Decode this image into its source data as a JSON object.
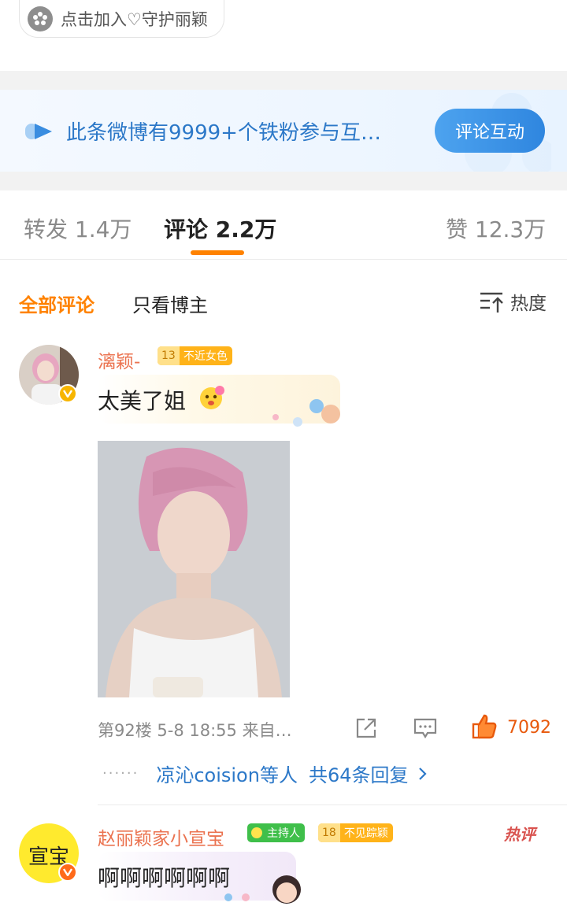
{
  "top": {
    "join_label": "点击加入♡守护丽颖"
  },
  "fans_banner": {
    "text": "此条微博有9999+个铁粉参与互…",
    "button_label": "评论互动"
  },
  "tabs": [
    {
      "label": "转发 1.4万"
    },
    {
      "label": "评论 2.2万"
    },
    {
      "label": "赞 12.3万"
    }
  ],
  "filter": {
    "all_label": "全部评论",
    "blogger_only_label": "只看博主",
    "sort_label": "热度"
  },
  "comments": [
    {
      "username": "漓颖-",
      "badge_level": "13",
      "badge_text": "不近女色",
      "text": "太美了姐",
      "meta": "第92楼  5-8 18:55  来自…",
      "like_count": "7092",
      "replies_names": "凉沁coision等人",
      "replies_total": "共64条回复"
    },
    {
      "username": "赵丽颖家小宣宝",
      "host_badge": "主持人",
      "badge_level": "18",
      "badge_text": "不见踪颖",
      "hot_label": "热评",
      "text": "啊啊啊啊啊啊",
      "avatar_text": "宣宝"
    }
  ],
  "colors": {
    "accent_orange": "#ff8200",
    "link_blue": "#2c78c8",
    "username": "#eb7350",
    "like": "#e8590c"
  }
}
